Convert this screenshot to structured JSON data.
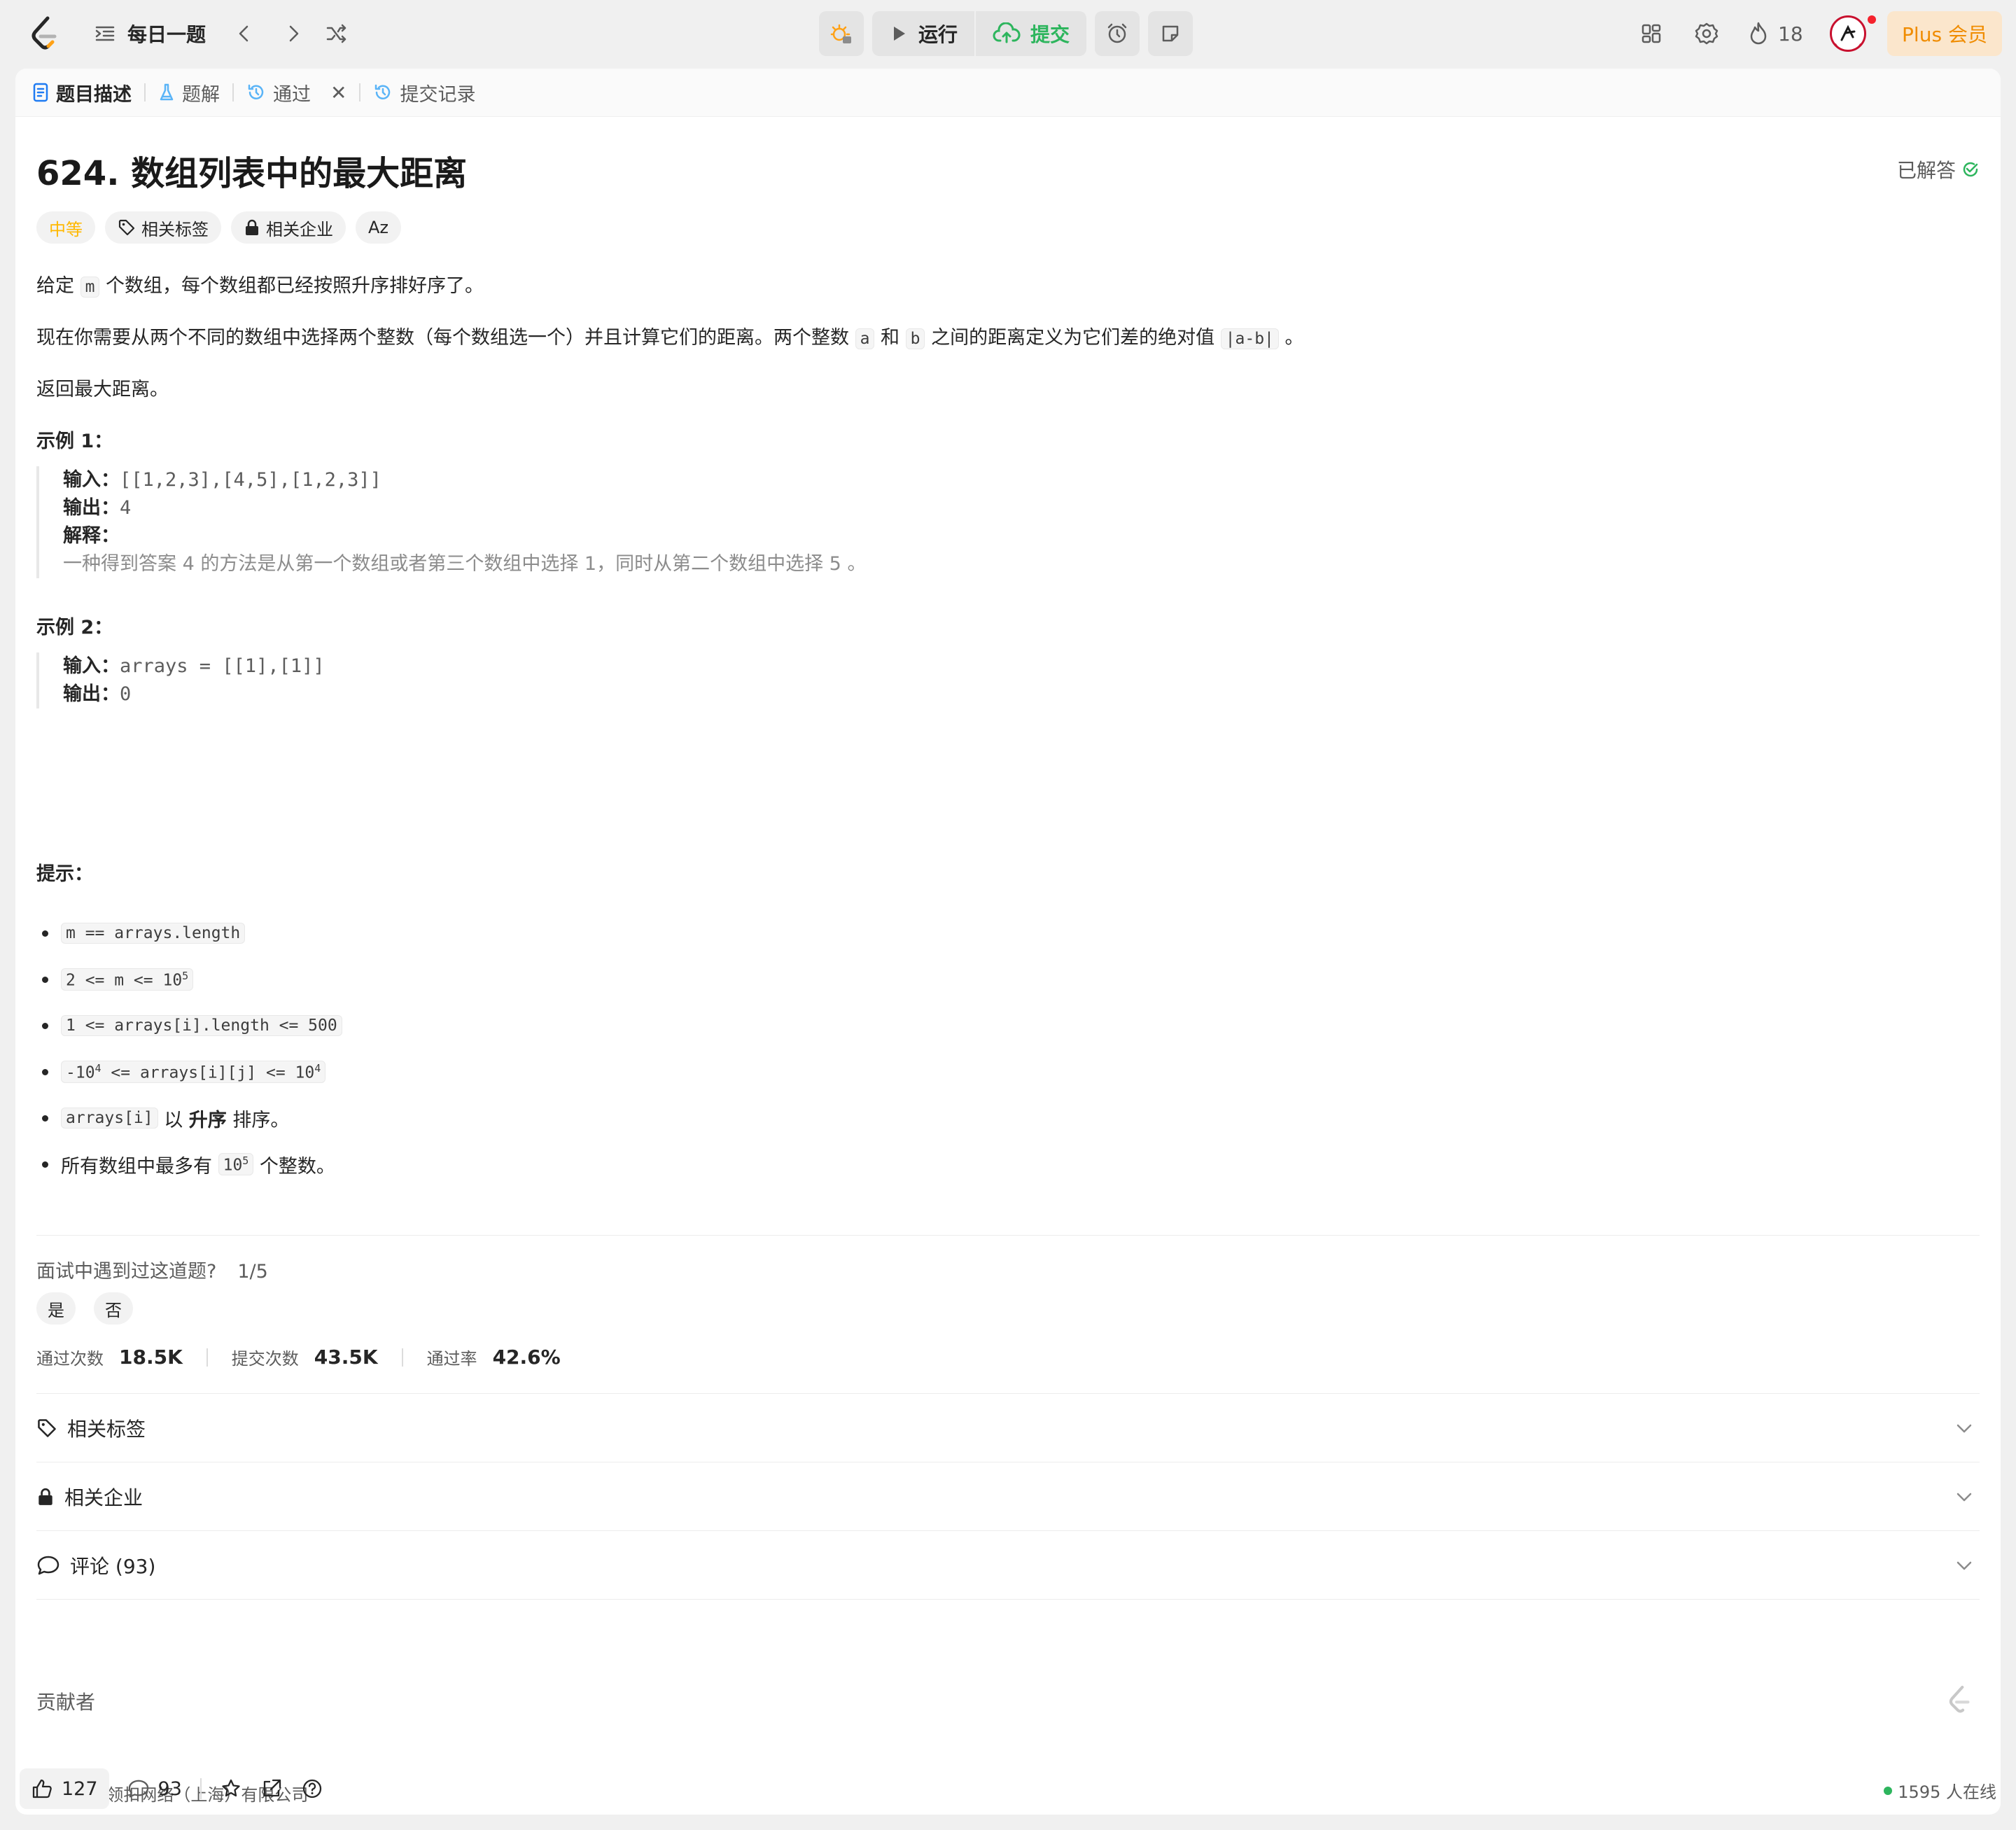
{
  "topbar": {
    "daily_label": "每日一题",
    "run_label": "运行",
    "submit_label": "提交",
    "streak_count": "18",
    "plus_label": "Plus 会员"
  },
  "tabs": [
    {
      "label": "题目描述"
    },
    {
      "label": "题解"
    },
    {
      "label": "通过"
    },
    {
      "label": "提交记录"
    }
  ],
  "problem": {
    "title": "624. 数组列表中的最大距离",
    "status": "已解答",
    "difficulty": "中等",
    "tag_topics": "相关标签",
    "tag_companies": "相关企业",
    "translate_glyph": "Aᴢ",
    "desc1": {
      "pre": "给定 ",
      "code": "m",
      "post": " 个数组，每个数组都已经按照升序排好序了。"
    },
    "desc2": {
      "pre": "现在你需要从两个不同的数组中选择两个整数（每个数组选一个）并且计算它们的距离。两个整数 ",
      "code_a": "a",
      "mid1": " 和 ",
      "code_b": "b",
      "mid2": " 之间的距离定义为它们差的绝对值 ",
      "code_abs": "|a-b|",
      "post": " 。"
    },
    "desc3": "返回最大距离。"
  },
  "examples": [
    {
      "heading": "示例 1：",
      "input_key": "输入：",
      "input_value": "[[1,2,3],[4,5],[1,2,3]]",
      "output_key": "输出：",
      "output_value": "4",
      "explain_key": "解释：",
      "explain_value": "一种得到答案 4 的方法是从第一个数组或者第三个数组中选择 1，同时从第二个数组中选择 5 。"
    },
    {
      "heading": "示例 2：",
      "input_key": "输入：",
      "input_value": "arrays = [[1],[1]]",
      "output_key": "输出：",
      "output_value": "0"
    }
  ],
  "constraints": {
    "heading": "提示：",
    "c1": "m == arrays.length",
    "c2_base": "2 <= m <= 10",
    "c2_exp": "5",
    "c3": "1 <= arrays[i].length <= 500",
    "c4_a": "-10",
    "c4_exp1": "4",
    "c4_b": " <= arrays[i][j] <= 10",
    "c4_exp2": "4",
    "c5_code": "arrays[i]",
    "c5_mid": " 以 ",
    "c5_bold": "升序",
    "c5_post": " 排序。",
    "c6_pre": "所有数组中最多有 ",
    "c6_base": "10",
    "c6_exp": "5",
    "c6_post": " 个整数。"
  },
  "interview": {
    "question": "面试中遇到过这道题?",
    "count": "1/5",
    "yes": "是",
    "no": "否"
  },
  "stats": {
    "accepted_label": "通过次数",
    "accepted_value": "18.5K",
    "submissions_label": "提交次数",
    "submissions_value": "43.5K",
    "rate_label": "通过率",
    "rate_value": "42.6%"
  },
  "sections": {
    "topics": "相关标签",
    "companies": "相关企业",
    "comments": "评论 (93)",
    "contributors": "贡献者"
  },
  "footer": {
    "copyright": "© 2025 领扣网络（上海）有限公司",
    "likes": "127",
    "comments": "93",
    "online": "1595 人在线"
  },
  "colors": {
    "accent_green": "#2db55d",
    "difficulty_medium": "#ffb800",
    "plus_orange": "#f08c00"
  }
}
